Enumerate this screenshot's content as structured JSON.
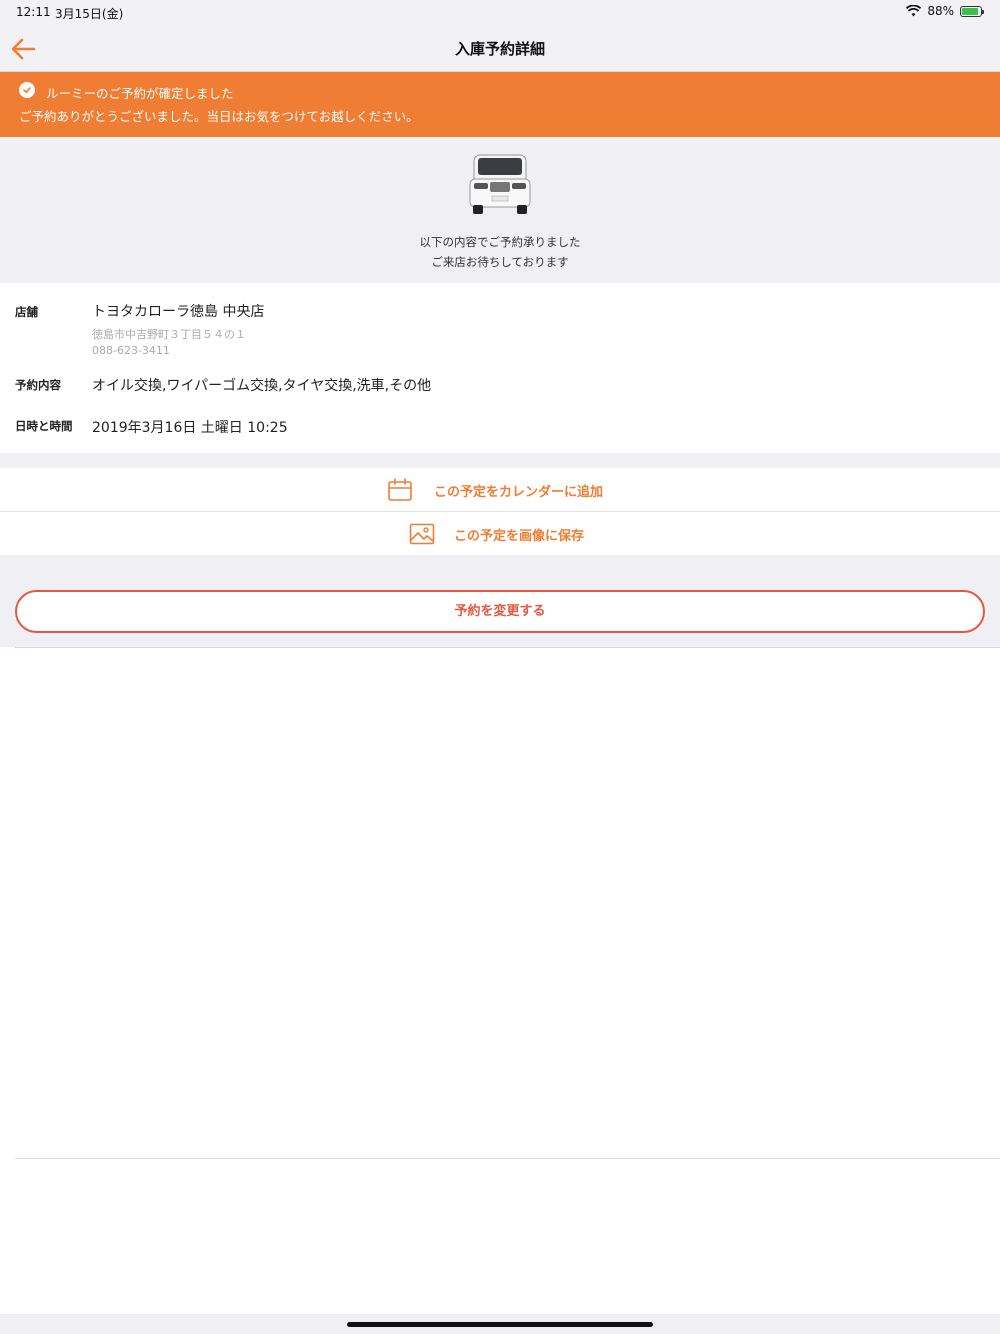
{
  "status_bar": {
    "time": "12:11",
    "date": "3月15日(金)",
    "battery_text": "88%",
    "battery_level": 0.88
  },
  "nav": {
    "title": "入庫予約詳細"
  },
  "banner": {
    "line1": "ルーミーのご予約が確定しました",
    "line2": "ご予約ありがとうございました。当日はお気をつけてお越しください。"
  },
  "hero": {
    "message1": "以下の内容でご予約承りました",
    "message2": "ご来店お待ちしております"
  },
  "details": {
    "store_label": "店舗",
    "store_name": "トヨタカローラ徳島 中央店",
    "store_address": "徳島市中吉野町３丁目５４の１",
    "store_phone": "088-623-3411",
    "content_label": "予約内容",
    "content_value": "オイル交換,ワイパーゴム交換,タイヤ交換,洗車,その他",
    "datetime_label": "日時と時間",
    "datetime_value": "2019年3月16日 土曜日 10:25"
  },
  "actions": {
    "add_calendar": "この予定をカレンダーに追加",
    "save_image": "この予定を画像に保存",
    "change_reservation": "予約を変更する"
  },
  "colors": {
    "accent": "#ef7d33",
    "button_red": "#e05a43",
    "background_gray": "#efeff4"
  }
}
